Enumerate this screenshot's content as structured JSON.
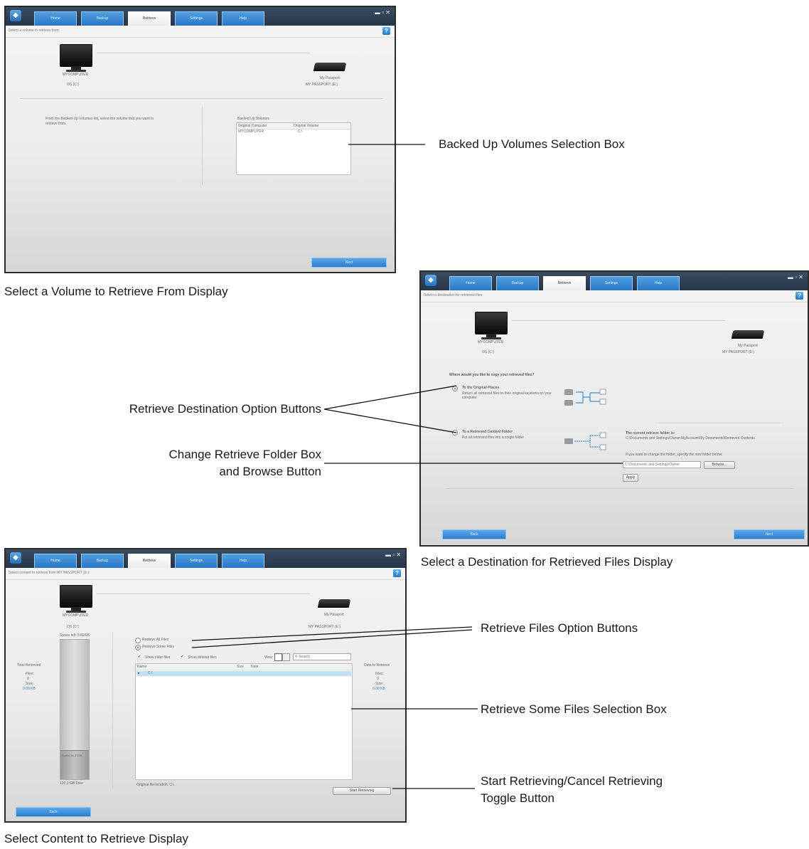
{
  "app": {
    "tabs": [
      "Home",
      "Backup",
      "Retrieve",
      "Settings",
      "Help"
    ],
    "active_tab": "Retrieve",
    "computer_label": "MYCOMPUTER",
    "drive_label": "My Passport",
    "help_glyph": "?"
  },
  "screen1": {
    "subtitle": "Select a volume to retrieve from:",
    "computer_disk": "OS (C:)",
    "drive_volume": "MY PASSPORT (E:)",
    "instructions": "From the Backed Up Volumes list, select the volume that you want to retrieve from.",
    "list_title": "Backed Up Volumes",
    "list_columns": [
      "Original Computer",
      "Original Volume"
    ],
    "list_rows": [
      [
        "MYCOMPUTER",
        "C:\\"
      ]
    ],
    "next_button": "Next",
    "caption": "Select a Volume to Retrieve From Display",
    "callout": "Backed Up Volumes Selection Box"
  },
  "screen2": {
    "subtitle": "Select a destination for retrieved files:",
    "computer_disk": "OS (C:)",
    "drive_volume": "MY PASSPORT (E:)",
    "question": "Where would you like to copy your retrieved files?",
    "option1_title": "To the Original Places",
    "option1_desc": "Return all retrieved files to their original locations on your computer",
    "option2_title": "To a Retrieved Content Folder",
    "option2_desc": "Put all retrieved files into a single folder",
    "current_folder_label": "The current retrieve folder is:",
    "current_folder_path": "C:\\Documents and Settings\\Owner.MyAccount\\My Documents\\Retrieved Contents",
    "change_prompt": "If you want to change the folder, specify the new folder below:",
    "folder_input": "C:\\Documents and Settings\\Owner",
    "browse_button": "Browse...",
    "apply_button": "Apply",
    "back_button": "Back",
    "next_button": "Next",
    "caption": "Select a Destination for Retrieved Files Display",
    "callout_options": "Retrieve Destination Option Buttons",
    "callout_folder_line1": "Change Retrieve Folder Box",
    "callout_folder_line2": "and Browse Button"
  },
  "screen3": {
    "subtitle": "Select content to retrieve from MY PASSPORT (E:):",
    "computer_disk": "OS (C:)",
    "drive_volume": "MY PASSPORT (E:)",
    "gauge_label": "Space left: 5.82GB",
    "gauge_free": "120.3 GB Free",
    "gauge_inner": "Space 60.27GB",
    "total_label": "Total Retrieved",
    "total_files_label": "Files:",
    "total_files": "0",
    "total_size_label": "Size:",
    "total_size": "0.00 KB",
    "left_label": "Data to Retrieve",
    "left_files_label": "Files:",
    "left_files": "0",
    "left_size_label": "Size:",
    "left_size": "0.00 KB",
    "option_all": "Retrieve All Files",
    "option_some": "Retrieve Some Files",
    "show_older": "Show older files",
    "show_deleted": "Show deleted files",
    "view_label": "View:",
    "search_placeholder": "Search",
    "columns": [
      "Name",
      "Size",
      "Date"
    ],
    "tree_root": "C:\\",
    "path_label": "Original file location: C:\\",
    "start_button": "Start Retrieving",
    "back_button": "Back",
    "caption": "Select Content to Retrieve Display",
    "callout_files_options": "Retrieve Files Option Buttons",
    "callout_some_files": "Retrieve Some Files Selection Box",
    "callout_toggle_line1": "Start Retrieving/Cancel Retrieving",
    "callout_toggle_line2": "Toggle Button"
  }
}
